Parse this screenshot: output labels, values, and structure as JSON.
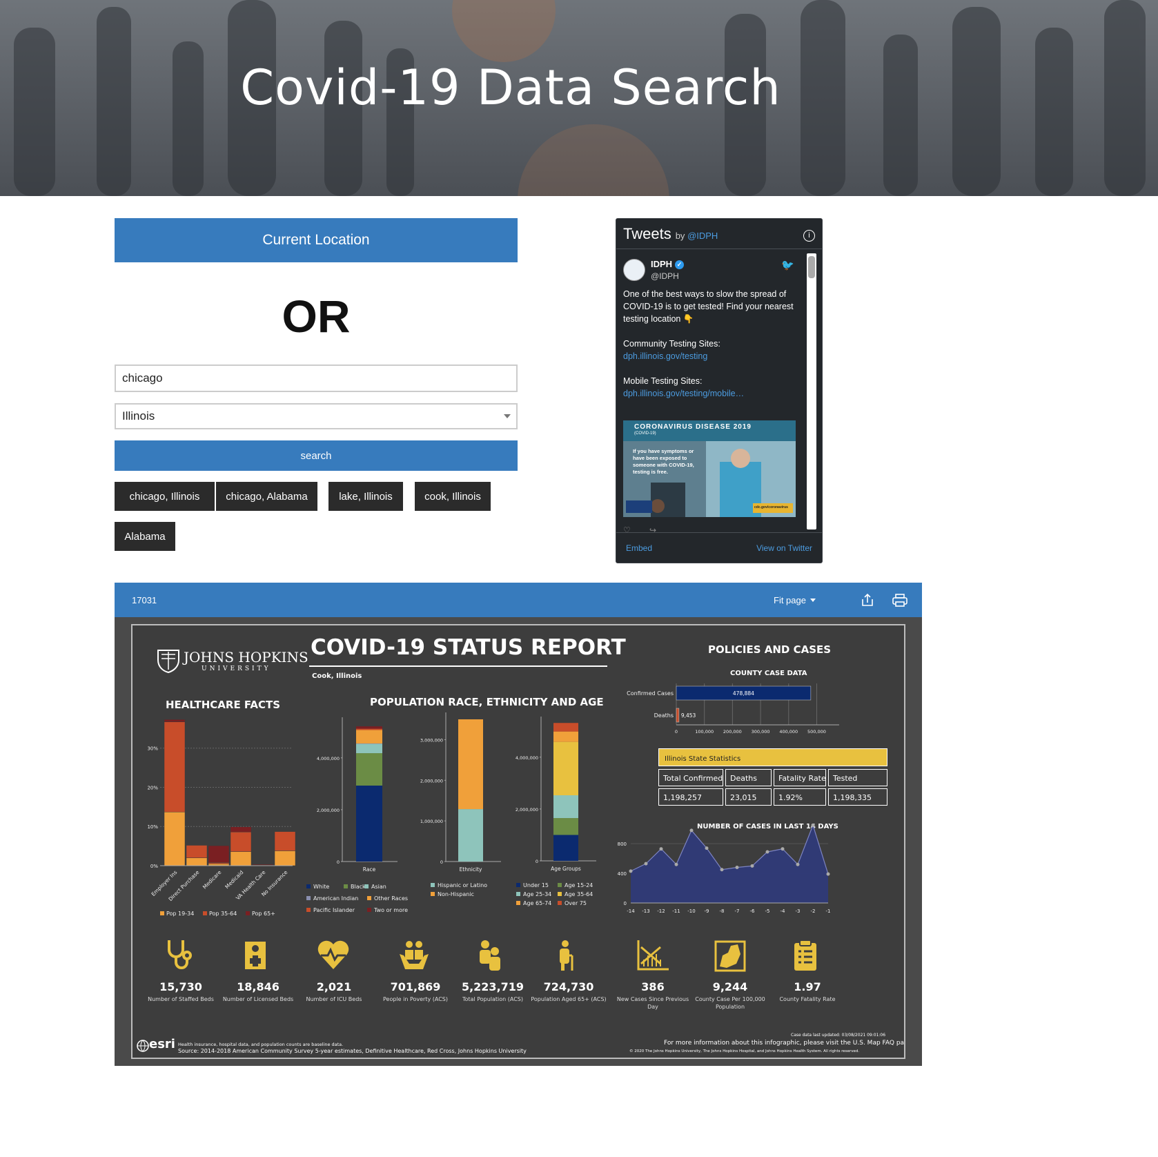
{
  "header": {
    "title": "Covid-19 Data Search"
  },
  "search": {
    "current_location": "Current Location",
    "or": "OR",
    "city_value": "chicago",
    "state_value": "Illinois",
    "search_label": "search",
    "chips": [
      "chicago, Illinois",
      "chicago, Alabama",
      "lake, Illinois",
      "cook, Illinois",
      "Alabama"
    ]
  },
  "twitter": {
    "title": "Tweets",
    "by": "by",
    "handle_link": "@IDPH",
    "name": "IDPH",
    "handle": "@IDPH",
    "text": "One of the best ways to slow the spread of COVID-19 is to get tested! Find your nearest testing location 👇",
    "community": "Community Testing Sites:",
    "community_link": "dph.illinois.gov/testing",
    "mobile": "Mobile Testing Sites:",
    "mobile_link": "dph.illinois.gov/testing/mobile…",
    "image_title": "CORONAVIRUS DISEASE 2019",
    "image_sub": "(COVID-19)",
    "image_text": "If you have symptoms or have been exposed to someone with COVID-19, testing is free.",
    "image_url": "cdc.gov/coronavirus",
    "embed": "Embed",
    "view": "View on Twitter"
  },
  "viewer": {
    "id": "17031",
    "fit": "Fit page"
  },
  "report": {
    "university": "JOHNS HOPKINS",
    "university_sub": "UNIVERSITY",
    "title": "COVID-19 STATUS REPORT",
    "location": "Cook, Illinois",
    "healthcare_title": "HEALTHCARE FACTS",
    "population_title": "POPULATION RACE, ETHNICITY AND AGE",
    "policies_title": "POLICIES AND CASES",
    "county_case_title": "COUNTY CASE DATA",
    "state_stats_title": "Illinois State Statistics",
    "state_headers": [
      "Total Confirmed",
      "Deaths",
      "Fatality Rate",
      "Tested"
    ],
    "state_values": [
      "1,198,257",
      "23,015",
      "1.92%",
      "1,198,335"
    ],
    "cases14_title": "NUMBER OF CASES IN LAST 14 DAYS",
    "race_axis": "Race",
    "ethnicity_axis": "Ethnicity",
    "age_axis": "Age Groups",
    "footer_note": "Health insurance, hospital data, and population counts are baseline data.",
    "footer_source": "Source: 2014-2018 American Community Survey 5-year estimates, Definitive Healthcare, Red Cross, Johns Hopkins University",
    "footer_updated": "Case data last updated: 03/08/2021 09:01:06",
    "footer_more": "For more information about this infographic, please visit the U.S. Map FAQ page",
    "footer_copy": "© 2020 The Johns Hopkins University, The Johns Hopkins Hospital, and Johns Hopkins Health System. All rights reserved.",
    "esri": "esri",
    "stats": [
      {
        "value": "15,730",
        "label": "Number of Staffed Beds",
        "icon": "stethoscope-icon"
      },
      {
        "value": "18,846",
        "label": "Number of Licensed Beds",
        "icon": "medical-kit-icon"
      },
      {
        "value": "2,021",
        "label": "Number of ICU Beds",
        "icon": "heart-pulse-icon"
      },
      {
        "value": "701,869",
        "label": "People in Poverty (ACS)",
        "icon": "hands-people-icon"
      },
      {
        "value": "5,223,719",
        "label": "Total Population (ACS)",
        "icon": "people-icon"
      },
      {
        "value": "724,730",
        "label": "Population Aged 65+ (ACS)",
        "icon": "elderly-icon"
      },
      {
        "value": "386",
        "label": "New Cases Since Previous Day",
        "icon": "trend-chart-icon"
      },
      {
        "value": "9,244",
        "label": "County Case Per 100,000 Population",
        "icon": "county-map-icon"
      },
      {
        "value": "1.97",
        "label": "County Fatality Rate",
        "icon": "clipboard-icon"
      }
    ]
  },
  "colors": {
    "accent": "#377bbd",
    "gold": "#e8c13f",
    "navy": "#0b2a6f",
    "dark": "#2b2b2b"
  },
  "chart_data": [
    {
      "type": "bar",
      "title": "HEALTHCARE FACTS",
      "categories": [
        "Employer Ins",
        "Direct Purchase",
        "Medicare",
        "Medicaid",
        "VA Health Care",
        "No Insurance"
      ],
      "ylim": [
        0,
        37
      ],
      "yticks": [
        "0%",
        "10%",
        "20%",
        "30%"
      ],
      "series": [
        {
          "name": "Pop 19-34",
          "values": [
            13.7,
            2,
            0.5,
            3.6,
            0.1,
            3.8
          ]
        },
        {
          "name": "Pop 35-64",
          "values": [
            23,
            3.2,
            0.3,
            5,
            0.1,
            4.9
          ]
        },
        {
          "name": "Pop 65+",
          "values": [
            0.6,
            0,
            4.3,
            1.3,
            0.2,
            0
          ]
        }
      ]
    },
    {
      "type": "bar",
      "xlabel": "Race",
      "yticks": [
        "0",
        "2,000,000",
        "4,000,000"
      ],
      "ylim": [
        0,
        5300000
      ],
      "series": [
        {
          "name": "White",
          "values": [
            2930000
          ]
        },
        {
          "name": "Black",
          "values": [
            1250000
          ]
        },
        {
          "name": "Asian",
          "values": [
            360000
          ]
        },
        {
          "name": "American Indian",
          "values": [
            15000
          ]
        },
        {
          "name": "Other Races",
          "values": [
            520000
          ]
        },
        {
          "name": "Pacific Islander",
          "values": [
            50000
          ]
        },
        {
          "name": "Two or more",
          "values": [
            90000
          ]
        }
      ]
    },
    {
      "type": "bar",
      "xlabel": "Ethnicity",
      "yticks": [
        "0",
        "1,000,000",
        "2,000,000",
        "3,000,000"
      ],
      "ylim": [
        0,
        3500000
      ],
      "series": [
        {
          "name": "Hispanic or Latino",
          "values": [
            1290000
          ]
        },
        {
          "name": "Non-Hispanic",
          "values": [
            2210000
          ]
        }
      ]
    },
    {
      "type": "bar",
      "xlabel": "Age Groups",
      "yticks": [
        "0",
        "2,000,000",
        "4,000,000"
      ],
      "ylim": [
        0,
        5300000
      ],
      "series": [
        {
          "name": "Under 15",
          "values": [
            1000000
          ]
        },
        {
          "name": "Age 15-24",
          "values": [
            650000
          ]
        },
        {
          "name": "Age 25-34",
          "values": [
            880000
          ]
        },
        {
          "name": "Age 35-64",
          "values": [
            2060000
          ]
        },
        {
          "name": "Age 65-74",
          "values": [
            400000
          ]
        },
        {
          "name": "Over 75",
          "values": [
            330000
          ]
        }
      ]
    },
    {
      "type": "bar",
      "title": "COUNTY CASE DATA",
      "categories": [
        "Confirmed Cases",
        "Deaths"
      ],
      "values": [
        478884,
        9453
      ],
      "labels": [
        "478,884",
        "9,453"
      ],
      "xticks": [
        "0",
        "100,000",
        "200,000",
        "300,000",
        "400,000",
        "500,000"
      ],
      "xlim": [
        0,
        580000
      ]
    },
    {
      "type": "area",
      "title": "NUMBER OF CASES IN LAST 14 DAYS",
      "x": [
        "-14",
        "-13",
        "-12",
        "-11",
        "-10",
        "-9",
        "-8",
        "-7",
        "-6",
        "-5",
        "-4",
        "-3",
        "-2",
        "-1"
      ],
      "values": [
        430,
        530,
        730,
        520,
        980,
        740,
        450,
        480,
        500,
        690,
        730,
        520,
        1050,
        390
      ],
      "ylim": [
        0,
        1100
      ],
      "yticks": [
        "0",
        "400",
        "800"
      ]
    }
  ]
}
